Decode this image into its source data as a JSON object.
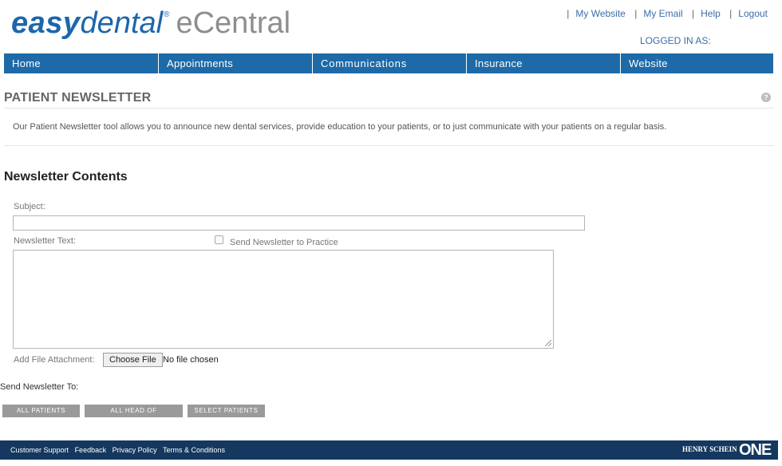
{
  "logo": {
    "easy": "easy",
    "dental": "dental",
    "reg": "®",
    "ecentral": "eCentral"
  },
  "top_links": [
    "My Website",
    "My Email",
    "Help",
    "Logout"
  ],
  "logged_in": "LOGGED IN AS:",
  "nav": [
    "Home",
    "Appointments",
    "Communications",
    "Insurance",
    "Website"
  ],
  "page": {
    "title": "PATIENT NEWSLETTER",
    "help_icon": "?",
    "intro": "Our Patient Newsletter tool allows you to announce new dental services, provide education to your patients, or to just communicate with your patients on a regular basis."
  },
  "form": {
    "section_title": "Newsletter Contents",
    "subject_label": "Subject:",
    "subject_value": "",
    "text_label": "Newsletter Text:",
    "send_to_practice": "Send Newsletter to Practice",
    "attachment_label": "Add File Attachment:",
    "choose_file": "Choose File",
    "no_file": "No file chosen",
    "send_to_label": "Send Newsletter To:"
  },
  "buttons": [
    "ALL PATIENTS",
    "ALL HEAD OF HOUSEHOLDS",
    "SELECT PATIENTS"
  ],
  "footer": {
    "links": [
      "Customer Support",
      "Feedback",
      "Privacy Policy",
      "Terms & Conditions"
    ],
    "brand_small": "HENRY SCHEIN",
    "brand_large": "ONE"
  },
  "colors": {
    "brand_blue": "#1c66ac",
    "nav_blue": "#1e6aa8",
    "footer_navy": "#14385f",
    "button_grey": "#9a9a9a"
  }
}
